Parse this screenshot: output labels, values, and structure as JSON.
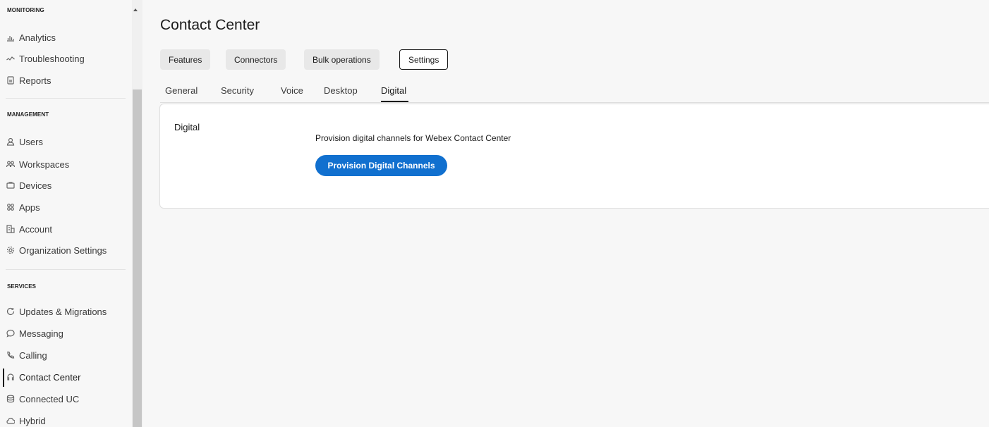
{
  "sidebar": {
    "sections": [
      {
        "heading": "MONITORING",
        "items": [
          {
            "label": "Analytics",
            "icon": "analytics-icon"
          },
          {
            "label": "Troubleshooting",
            "icon": "troubleshooting-icon"
          },
          {
            "label": "Reports",
            "icon": "reports-icon"
          }
        ]
      },
      {
        "heading": "MANAGEMENT",
        "items": [
          {
            "label": "Users",
            "icon": "user-icon"
          },
          {
            "label": "Workspaces",
            "icon": "workspaces-icon"
          },
          {
            "label": "Devices",
            "icon": "devices-icon"
          },
          {
            "label": "Apps",
            "icon": "apps-icon"
          },
          {
            "label": "Account",
            "icon": "account-icon"
          },
          {
            "label": "Organization Settings",
            "icon": "gear-icon"
          }
        ]
      },
      {
        "heading": "SERVICES",
        "items": [
          {
            "label": "Updates & Migrations",
            "icon": "refresh-icon"
          },
          {
            "label": "Messaging",
            "icon": "message-icon"
          },
          {
            "label": "Calling",
            "icon": "phone-icon"
          },
          {
            "label": "Contact Center",
            "icon": "contact-center-icon",
            "active": true
          },
          {
            "label": "Connected UC",
            "icon": "connected-uc-icon"
          },
          {
            "label": "Hybrid",
            "icon": "cloud-icon"
          }
        ]
      }
    ]
  },
  "main": {
    "title": "Contact Center",
    "top_tabs": [
      {
        "label": "Features"
      },
      {
        "label": "Connectors"
      },
      {
        "label": "Bulk operations"
      },
      {
        "label": "Settings",
        "selected": true
      }
    ],
    "sub_tabs": [
      {
        "label": "General"
      },
      {
        "label": "Security"
      },
      {
        "label": "Voice"
      },
      {
        "label": "Desktop"
      },
      {
        "label": "Digital",
        "selected": true
      }
    ],
    "card": {
      "title": "Digital",
      "description": "Provision digital channels for Webex Contact Center",
      "button_label": "Provision Digital Channels"
    }
  },
  "colors": {
    "accent": "#1170cf",
    "background": "#f7f7f7",
    "text": "#1b1b1b"
  }
}
